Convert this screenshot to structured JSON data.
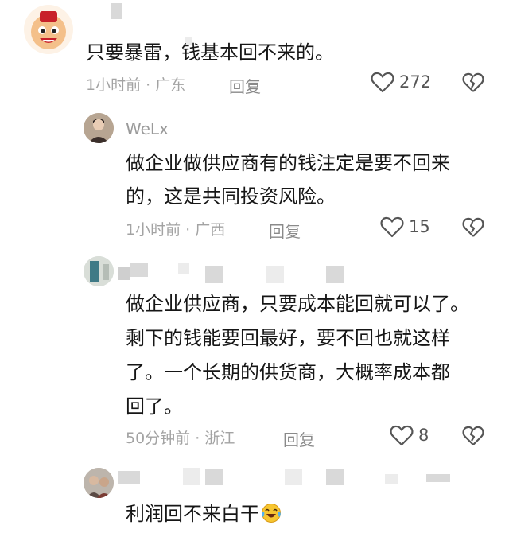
{
  "comments": [
    {
      "text": "只要暴雷，钱基本回不来的。",
      "time": "1小时前",
      "location": "广东",
      "reply_label": "回复",
      "likes": "272"
    },
    {
      "username": "WeLx",
      "text_lines": [
        "做企业做供应商有的钱注定是要不回来",
        "的，这是共同投资风险。"
      ],
      "time": "1小时前",
      "location": "广西",
      "reply_label": "回复",
      "likes": "15"
    },
    {
      "text_lines": [
        "做企业供应商，只要成本能回就可以了。",
        "剩下的钱能要回最好，要不回也就这样",
        "了。一个长期的供货商，大概率成本都",
        "回了。"
      ],
      "time": "50分钟前",
      "location": "浙江",
      "reply_label": "回复",
      "likes": "8"
    },
    {
      "text": "利润回不来白干"
    }
  ],
  "meta_separator": " · ",
  "icons": [
    "heart-icon",
    "broken-heart-icon",
    "laughing-crying-emoji"
  ]
}
